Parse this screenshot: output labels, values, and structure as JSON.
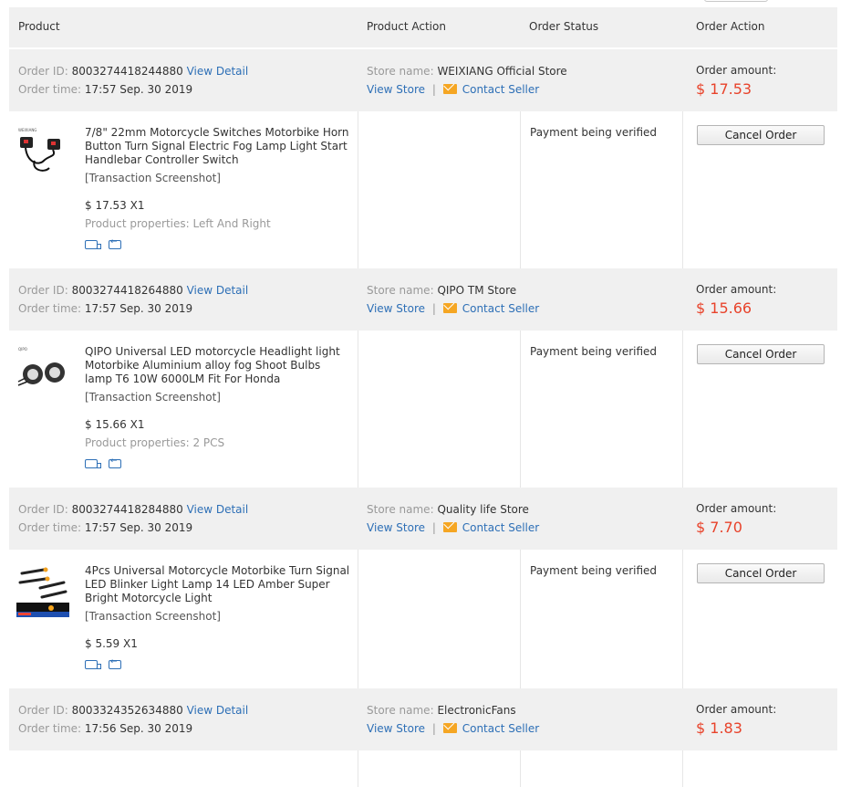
{
  "header": {
    "product": "Product",
    "product_action": "Product Action",
    "order_status": "Order Status",
    "order_action": "Order Action"
  },
  "labels": {
    "order_id": "Order ID:",
    "view_detail": "View Detail",
    "order_time": "Order time:",
    "store_name": "Store name:",
    "view_store": "View Store",
    "separator": "|",
    "contact_seller": "Contact Seller",
    "order_amount": "Order amount:",
    "transaction_screenshot": "[Transaction Screenshot]",
    "product_properties": "Product properties:",
    "cancel_order": "Cancel Order"
  },
  "orders": [
    {
      "id": "8003274418244880",
      "time": "17:57 Sep. 30 2019",
      "store": "WEIXIANG Official Store",
      "amount": "$ 17.53",
      "product_title": "7/8\" 22mm Motorcycle Switches Motorbike Horn Button Turn Signal Electric Fog Lamp Light Start Handlebar Controller Switch",
      "price_qty": "$ 17.53 X1",
      "properties": "Left And Right",
      "status": "Payment being verified"
    },
    {
      "id": "8003274418264880",
      "time": "17:57 Sep. 30 2019",
      "store": "QIPO TM Store",
      "amount": "$ 15.66",
      "product_title": "QIPO Universal LED motorcycle Headlight light Motorbike Aluminium alloy fog Shoot Bulbs lamp T6 10W 6000LM Fit For Honda",
      "price_qty": "$ 15.66 X1",
      "properties": "2 PCS",
      "status": "Payment being verified"
    },
    {
      "id": "8003274418284880",
      "time": "17:57 Sep. 30 2019",
      "store": "Quality life Store",
      "amount": "$ 7.70",
      "product_title": "4Pcs Universal Motorcycle Motorbike Turn Signal LED Blinker Light Lamp 14 LED Amber Super Bright Motorcycle Light",
      "price_qty": "$ 5.59 X1",
      "status": "Payment being verified"
    },
    {
      "id": "8003324352634880",
      "time": "17:56 Sep. 30 2019",
      "store": "ElectronicFans",
      "amount": "$ 1.83"
    }
  ]
}
